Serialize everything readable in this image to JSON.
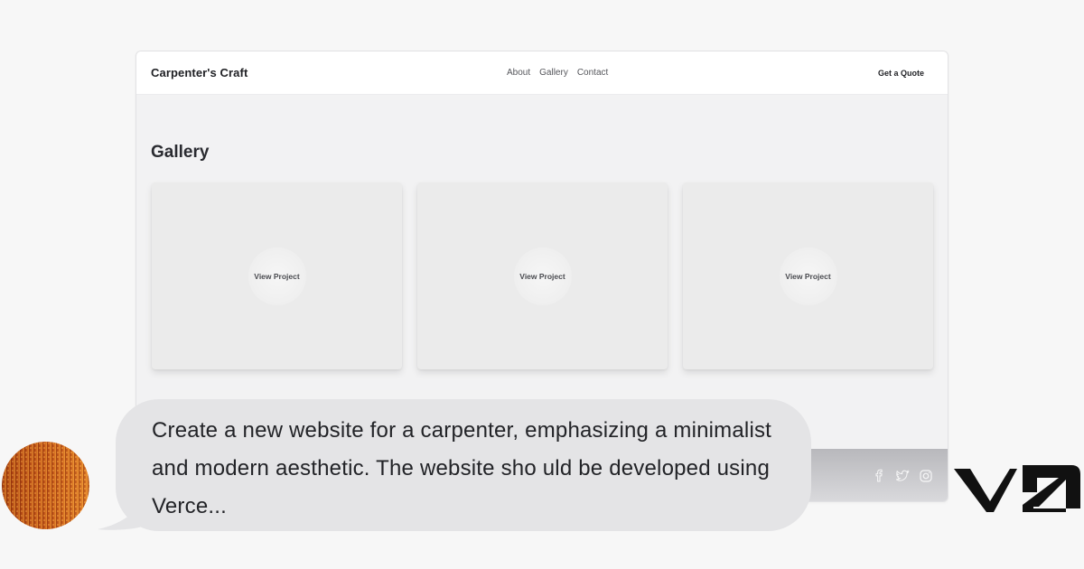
{
  "site": {
    "brand": "Carpenter's Craft",
    "nav": [
      "About",
      "Gallery",
      "Contact"
    ],
    "cta_label": "Get a Quote",
    "gallery_title": "Gallery",
    "cards": [
      {
        "label": "View Project"
      },
      {
        "label": "View Project"
      },
      {
        "label": "View Project"
      }
    ],
    "social_icons": [
      "facebook-icon",
      "twitter-icon",
      "instagram-icon"
    ]
  },
  "chat": {
    "prompt": "Create a new website for a carpenter, emphasizing a minimalist and modern aesthetic. The website sho uld be developed using Verce..."
  },
  "brand_logo": {
    "name": "v0-logo",
    "text": "V0"
  },
  "colors": {
    "page_bg": "#f7f7f7",
    "bubble_bg": "#e4e4e6",
    "card_bg": "#ebebeb",
    "avatar_dark": "#8a2d0a",
    "avatar_light": "#f7a43a"
  }
}
